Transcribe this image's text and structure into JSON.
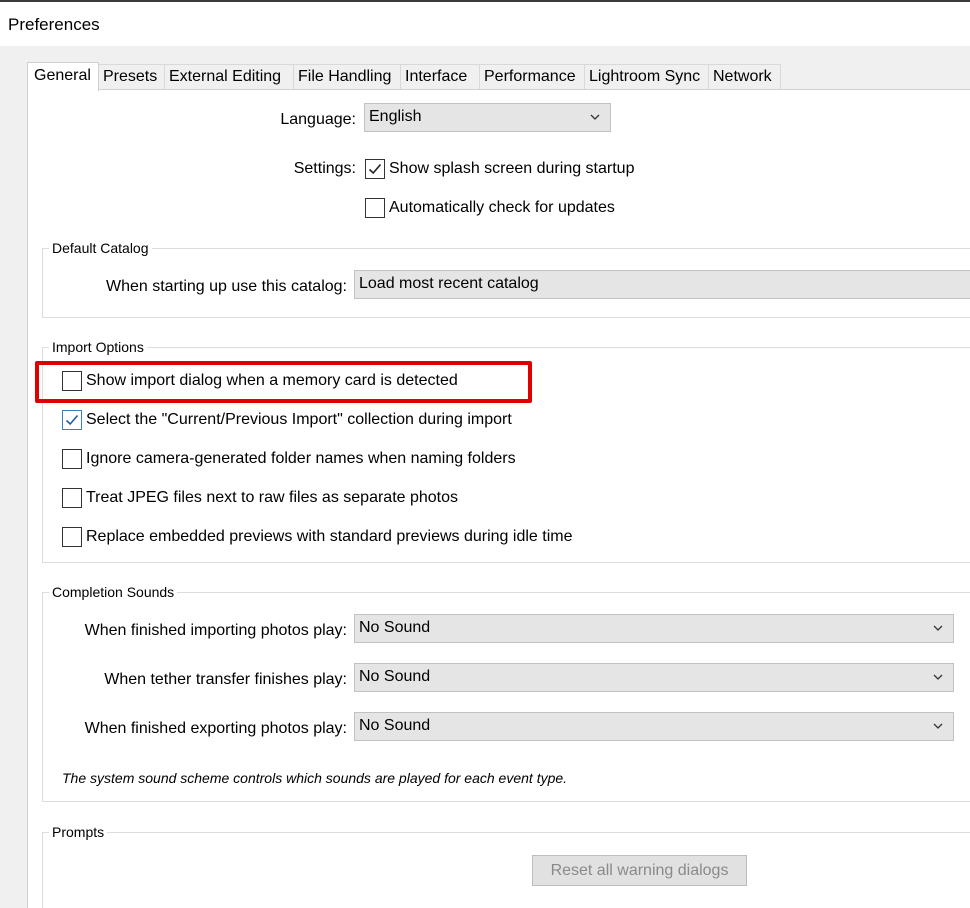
{
  "window": {
    "title": "Preferences"
  },
  "tabs": [
    {
      "label": "General",
      "active": true
    },
    {
      "label": "Presets"
    },
    {
      "label": "External Editing"
    },
    {
      "label": "File Handling"
    },
    {
      "label": "Interface"
    },
    {
      "label": "Performance"
    },
    {
      "label": "Lightroom Sync"
    },
    {
      "label": "Network"
    }
  ],
  "general": {
    "language_label": "Language:",
    "language_value": "English",
    "settings_label": "Settings:",
    "splash_label": "Show splash screen during startup",
    "splash_checked": true,
    "updates_label": "Automatically check for updates",
    "updates_checked": false
  },
  "default_catalog": {
    "group_label": "Default Catalog",
    "catalog_label": "When starting up use this catalog:",
    "catalog_value": "Load most recent catalog"
  },
  "import_options": {
    "group_label": "Import Options",
    "items": [
      {
        "label": "Show import dialog when a memory card is detected",
        "checked": false
      },
      {
        "label": "Select the \"Current/Previous Import\" collection during import",
        "checked": true
      },
      {
        "label": "Ignore camera-generated folder names when naming folders",
        "checked": false
      },
      {
        "label": "Treat JPEG files next to raw files as separate photos",
        "checked": false
      },
      {
        "label": "Replace embedded previews with standard previews during idle time",
        "checked": false
      }
    ]
  },
  "completion_sounds": {
    "group_label": "Completion Sounds",
    "rows": [
      {
        "label": "When finished importing photos play:",
        "value": "No Sound"
      },
      {
        "label": "When tether transfer finishes play:",
        "value": "No Sound"
      },
      {
        "label": "When finished exporting photos play:",
        "value": "No Sound"
      }
    ],
    "note": "The system sound scheme controls which sounds are played for each event type."
  },
  "prompts": {
    "group_label": "Prompts",
    "reset_button": "Reset all warning dialogs"
  },
  "colors": {
    "highlight": "#e00000",
    "check_accent": "#3a7fc1"
  },
  "icons": {
    "checkmark": "checkmark-icon",
    "dropdown": "chevron-down-icon"
  }
}
